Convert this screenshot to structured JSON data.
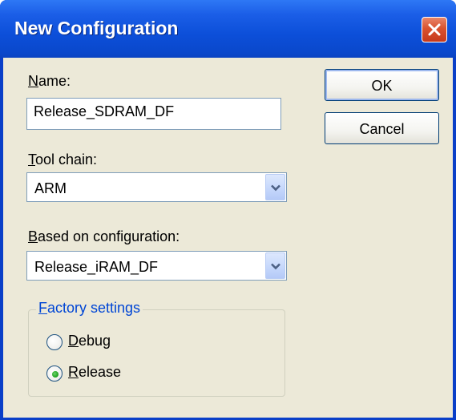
{
  "window": {
    "title": "New Configuration"
  },
  "name_field": {
    "label_accel": "N",
    "label_rest": "ame:",
    "value": "Release_SDRAM_DF"
  },
  "tool_chain": {
    "label_accel": "T",
    "label_rest": "ool chain:",
    "selected": "ARM"
  },
  "based_on": {
    "label_accel": "B",
    "label_rest": "ased on configuration:",
    "selected": "Release_iRAM_DF"
  },
  "factory_settings": {
    "legend_accel": "F",
    "legend_rest": "actory settings",
    "options": [
      {
        "accel": "D",
        "rest": "ebug",
        "checked": false
      },
      {
        "accel": "R",
        "rest": "elease",
        "checked": true
      }
    ]
  },
  "buttons": {
    "ok": "OK",
    "cancel": "Cancel"
  },
  "colors": {
    "title_bar": "#0a48cc",
    "dialog_face": "#ece9d8",
    "close_button": "#d9522f",
    "group_legend": "#0046d5"
  },
  "icons": {
    "close": "close-icon",
    "dropdown": "chevron-down-icon"
  }
}
